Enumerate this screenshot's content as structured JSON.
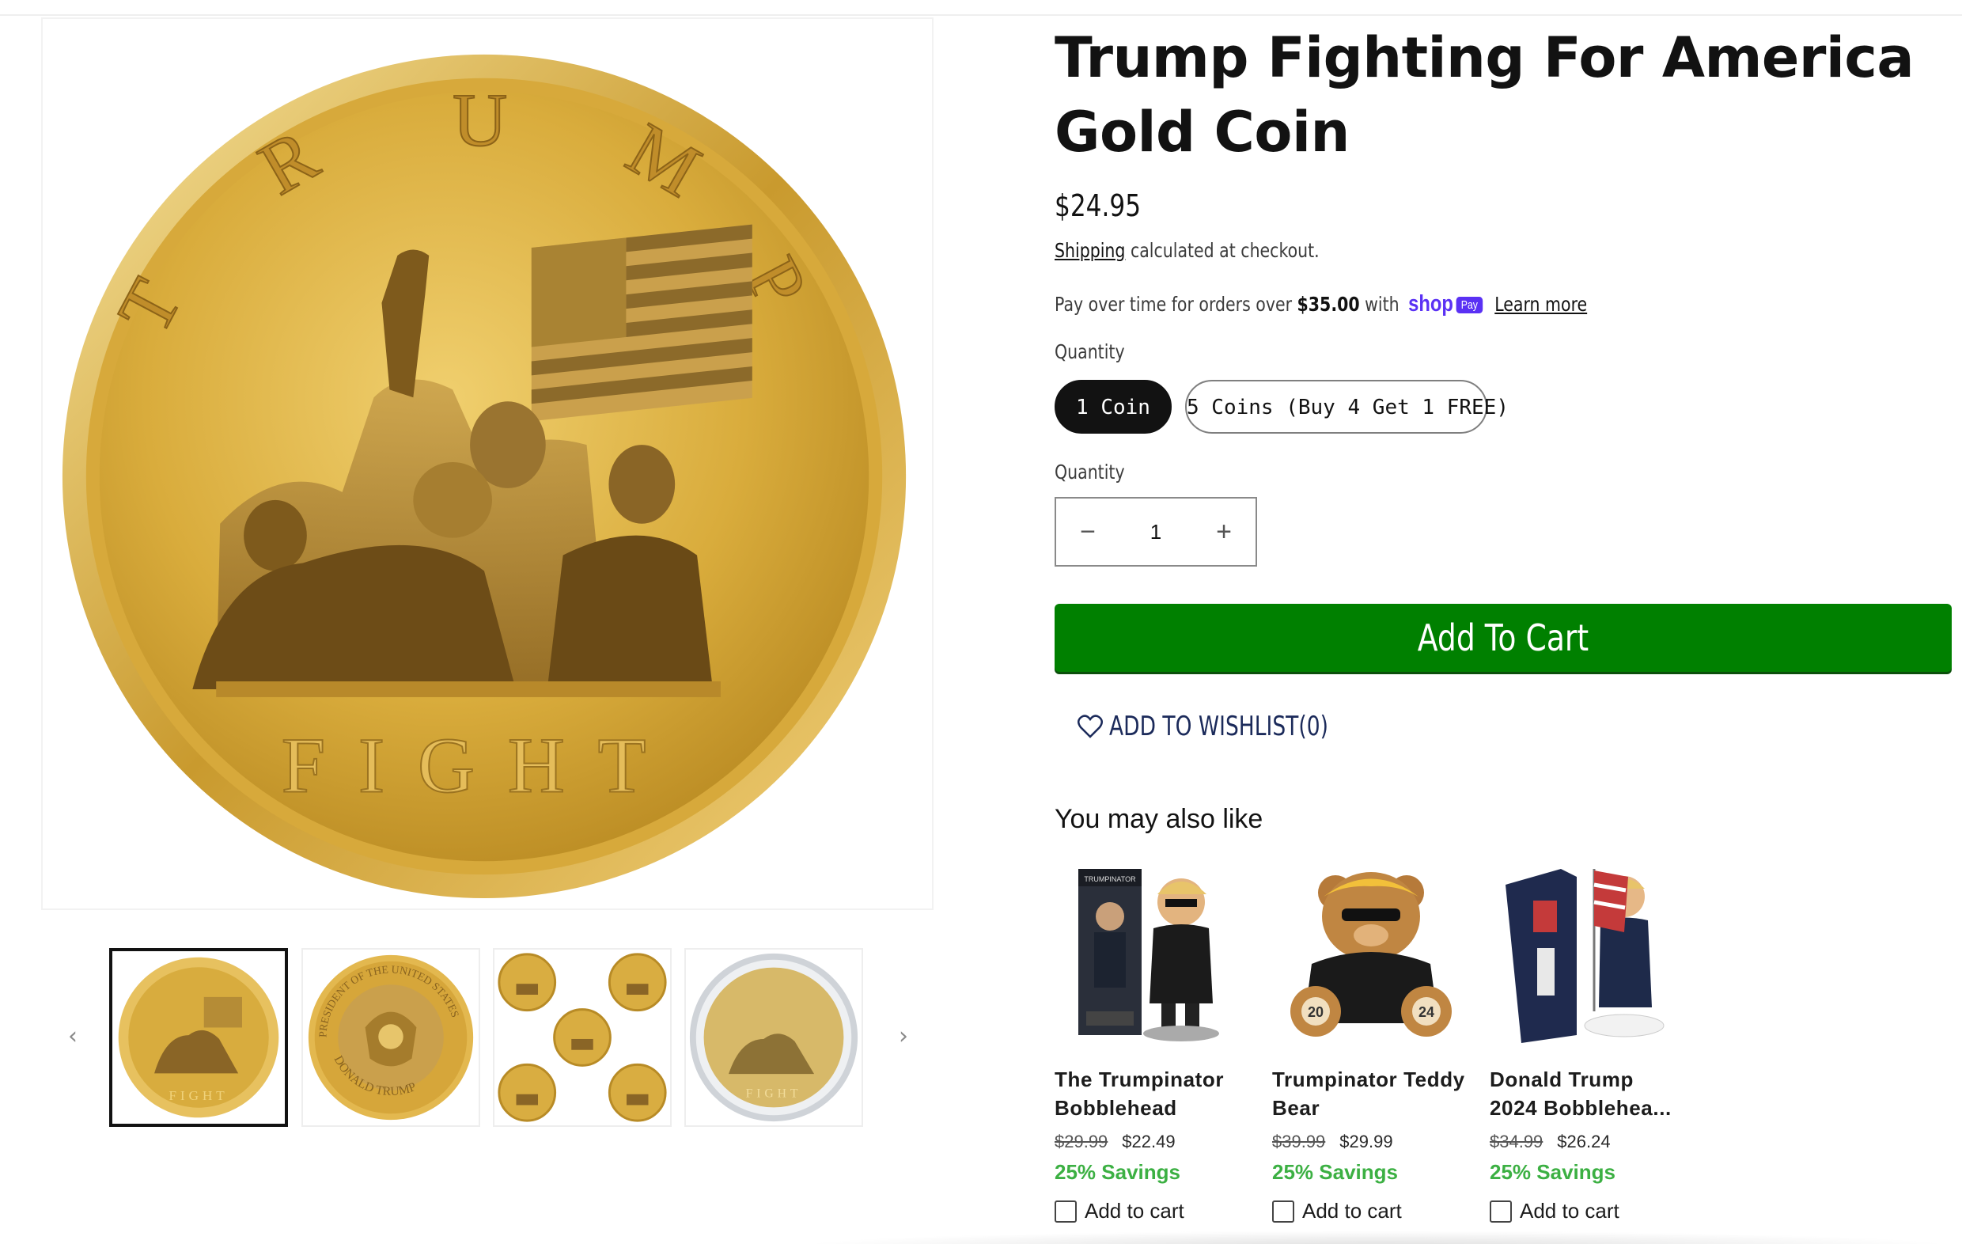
{
  "product": {
    "title": "Trump Fighting For America Gold Coin",
    "price": "$24.95",
    "shipping_link": "Shipping",
    "shipping_rest": "calculated at checkout.",
    "pay_over_time": "Pay over time for orders over",
    "pay_threshold": "$35.00",
    "pay_with": "with",
    "shop_logo": "shop",
    "pay_badge": "Pay",
    "learn_more": "Learn more"
  },
  "variant": {
    "label": "Quantity",
    "options": [
      "1 Coin",
      "5 Coins (Buy 4 Get 1 FREE)"
    ],
    "selected": "1 Coin"
  },
  "quantity": {
    "label": "Quantity",
    "value": "1",
    "minus": "−",
    "plus": "+"
  },
  "actions": {
    "add_to_cart": "Add To Cart",
    "wishlist": "ADD TO WISHLIST",
    "wishlist_count": "(0)"
  },
  "gallery": {
    "coin_top_text": [
      "T",
      "R",
      "U",
      "M",
      "P"
    ],
    "coin_bottom_text": "FIGHT",
    "thumb_seal_text_top": "PRESIDENT OF THE UNITED STATES",
    "thumb_seal_text_bottom": "DONALD TRUMP",
    "prev_arrow": "‹",
    "next_arrow": "›",
    "colors": {
      "gold": "#d4a93f",
      "gold_light": "#f3d88a",
      "gold_dark": "#a87d1e"
    }
  },
  "recommendations": {
    "heading": "You may also like",
    "items": [
      {
        "name": "The Trumpinator Bobblehead",
        "old_price": "$29.99",
        "price": "$22.49",
        "savings": "25% Savings",
        "add": "Add to cart",
        "box_text": "TRUMPINATOR"
      },
      {
        "name": "Trumpinator Teddy Bear",
        "old_price": "$39.99",
        "price": "$29.99",
        "savings": "25% Savings",
        "add": "Add to cart",
        "paw_left": "20",
        "paw_right": "24"
      },
      {
        "name": "Donald Trump 2024 Bobblehea...",
        "old_price": "$34.99",
        "price": "$26.24",
        "savings": "25% Savings",
        "add": "Add to cart"
      }
    ]
  },
  "theme": {
    "accent_green": "#008000",
    "savings_green": "#3cb043",
    "shop_purple": "#5a31f4"
  }
}
